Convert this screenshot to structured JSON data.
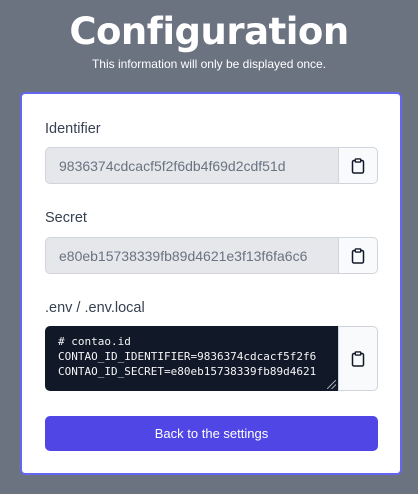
{
  "header": {
    "title": "Configuration",
    "subtitle": "This information will only be displayed once."
  },
  "identifier": {
    "label": "Identifier",
    "value": "9836374cdcacf5f2f6db4f69d2cdf51d",
    "copy_icon": "clipboard-icon"
  },
  "secret": {
    "label": "Secret",
    "value": "e80eb15738339fb89d4621e3f13f6fa6c6",
    "copy_icon": "clipboard-icon"
  },
  "env": {
    "label": ".env / .env.local",
    "lines": [
      "# contao.id",
      "CONTAO_ID_IDENTIFIER=9836374cdcacf5f2f6",
      "CONTAO_ID_SECRET=e80eb15738339fb89d4621"
    ],
    "copy_icon": "clipboard-icon"
  },
  "actions": {
    "back_label": "Back to the settings"
  },
  "colors": {
    "background": "#6b7280",
    "accent": "#4f46e5",
    "card_border": "#6366f1",
    "code_bg": "#111827"
  }
}
